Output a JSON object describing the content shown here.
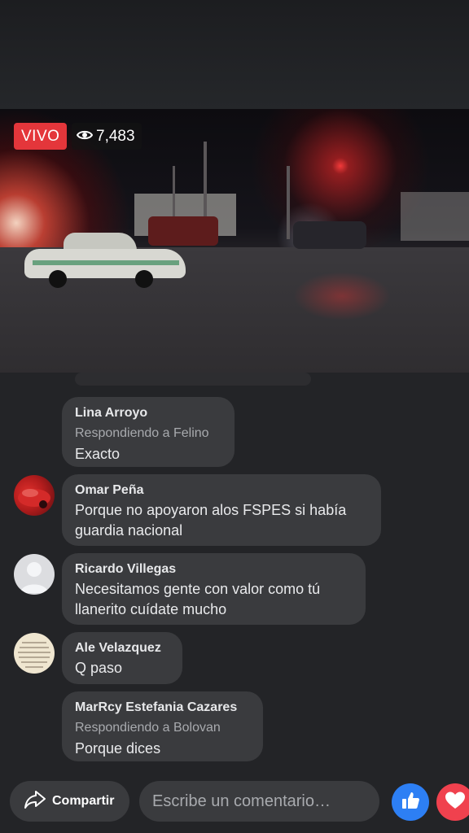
{
  "live": {
    "badge": "VIVO",
    "viewers": "7,483",
    "badge_color": "#e4363b"
  },
  "comments": [
    {
      "author": "Lina Arroyo",
      "reply_to": "Respondiendo a Felino",
      "text": "Exacto",
      "avatar": "none"
    },
    {
      "author": "Omar Peña",
      "reply_to": "",
      "text": "Porque no apoyaron alos FSPES si había guardia nacional",
      "avatar": "red-car-photo"
    },
    {
      "author": "Ricardo Villegas",
      "reply_to": "",
      "text": "Necesitamos gente con valor como tú llanerito cuídate mucho",
      "avatar": "default-person"
    },
    {
      "author": "Ale Velazquez",
      "reply_to": "",
      "text": "Q paso",
      "avatar": "quote-text-image"
    },
    {
      "author": "MarRcy Estefania Cazares",
      "reply_to": "Respondiendo a Bolovan",
      "text": "Porque dices",
      "avatar": "none"
    }
  ],
  "footer": {
    "share_label": "Compartir",
    "comment_placeholder": "Escribe un comentario…",
    "like_icon": "thumbs-up-icon",
    "love_icon": "heart-icon",
    "like_color": "#2d7ff4",
    "love_color": "#f0414e"
  }
}
